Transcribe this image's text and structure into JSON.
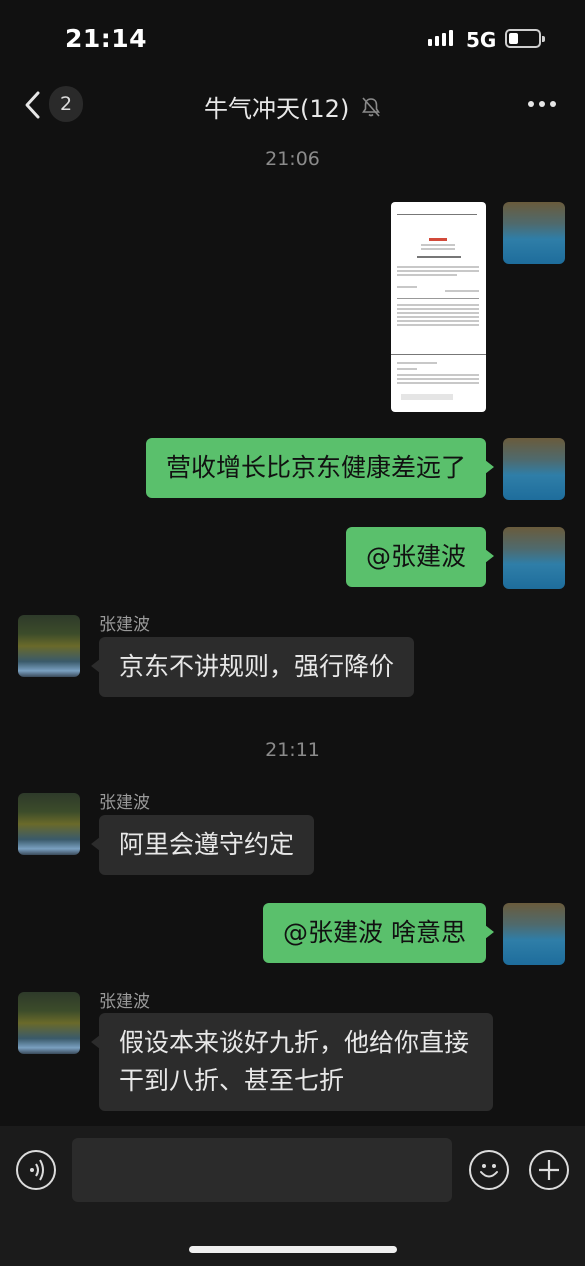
{
  "status_bar": {
    "time": "21:14",
    "network": "5G"
  },
  "nav": {
    "unread_count": "2",
    "title": "牛气冲天(12)"
  },
  "messages": {
    "time_1": "21:06",
    "msg_1": "营收增长比京东健康差远了",
    "msg_2": "@张建波",
    "reply_1_sender": "张建波",
    "reply_1": "京东不讲规则，强行降价",
    "time_2": "21:11",
    "reply_2_sender": "张建波",
    "reply_2": "阿里会遵守约定",
    "msg_3": "@张建波 啥意思",
    "reply_3_sender": "张建波",
    "reply_3": "假设本来谈好九折，他给你直接干到八折、甚至七折"
  },
  "input": {
    "placeholder": ""
  },
  "colors": {
    "background": "#111111",
    "outgoing_bubble": "#5ac06c",
    "incoming_bubble": "#2c2c2c"
  }
}
